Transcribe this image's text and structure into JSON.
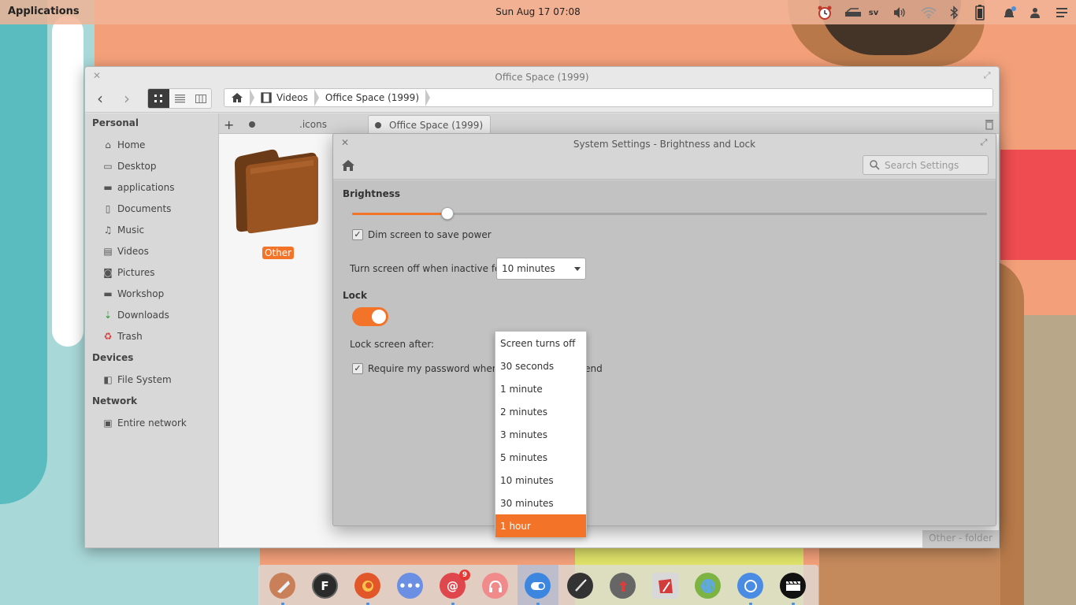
{
  "panel": {
    "applications": "Applications",
    "clock": "Sun Aug 17 07:08",
    "keyboard_layout": "sv"
  },
  "file_manager": {
    "title": "Office Space (1999)",
    "path": [
      "Videos",
      "Office Space (1999)"
    ],
    "sidebar": {
      "personal": "Personal",
      "personal_items": [
        "Home",
        "Desktop",
        "applications",
        "Documents",
        "Music",
        "Videos",
        "Pictures",
        "Workshop",
        "Downloads",
        "Trash"
      ],
      "devices": "Devices",
      "device_items": [
        "File System"
      ],
      "network": "Network",
      "network_items": [
        "Entire network"
      ]
    },
    "tabs": [
      ".icons",
      "Office Space (1999)"
    ],
    "folder_label": "Other",
    "status": "Other - folder"
  },
  "settings": {
    "title": "System Settings - Brightness and Lock",
    "search_placeholder": "Search Settings",
    "brightness_title": "Brightness",
    "brightness_level": 0.15,
    "dim_label": "Dim screen to save power",
    "screen_off_label": "Turn screen off when inactive for:",
    "screen_off_value": "10 minutes",
    "lock_title": "Lock",
    "lock_enabled": true,
    "lock_after_label": "Lock screen after:",
    "require_password_label": "Require my password when waking from suspend"
  },
  "dropdown": {
    "options": [
      "Screen turns off",
      "30 seconds",
      "1 minute",
      "2 minutes",
      "3 minutes",
      "5 minutes",
      "10 minutes",
      "30 minutes",
      "1 hour"
    ],
    "selected": "1 hour"
  },
  "dock": {
    "mail_badge": "9"
  },
  "colors": {
    "accent": "#f37329"
  }
}
